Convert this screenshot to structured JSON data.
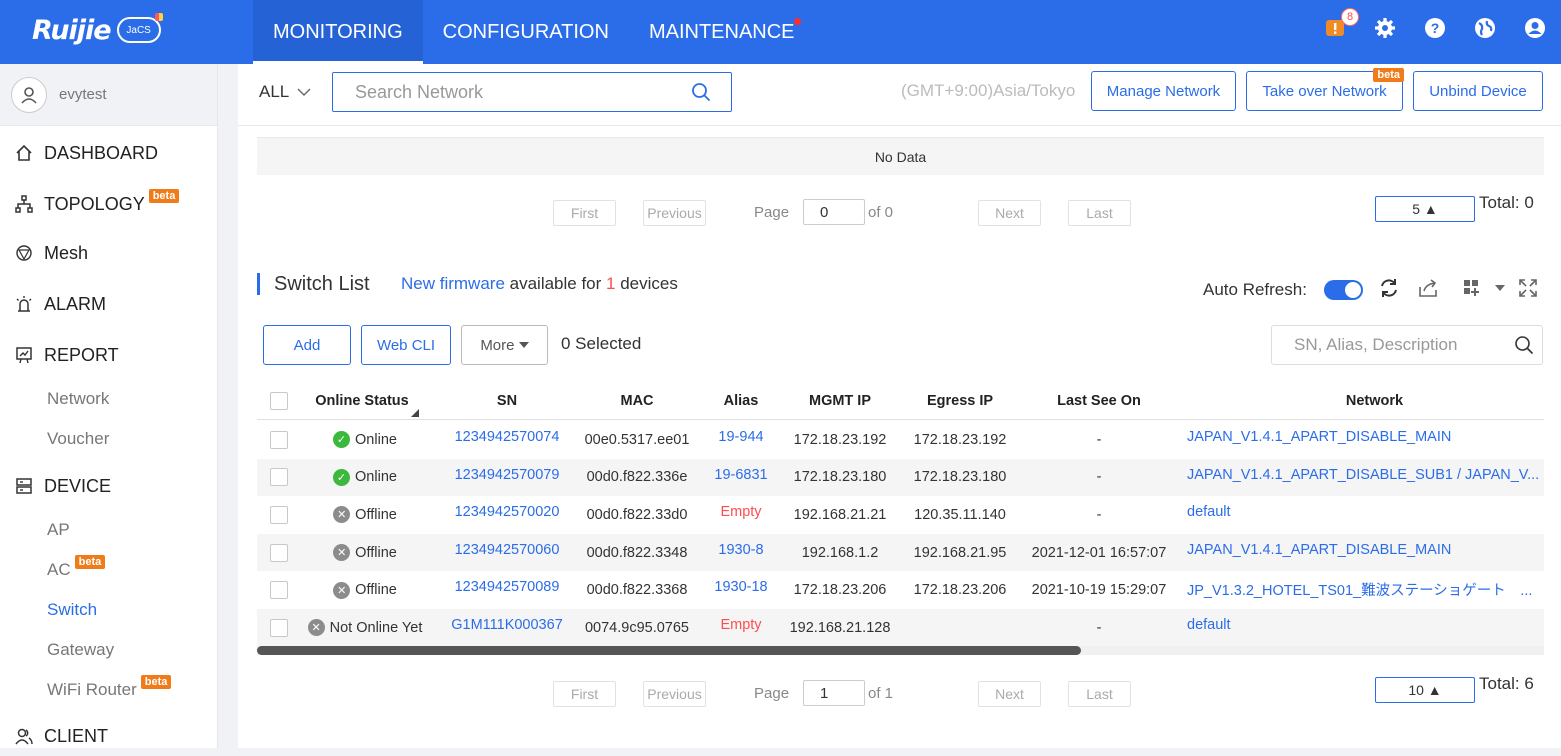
{
  "header": {
    "brand": "Ruijie",
    "brand_sub": "JaCS",
    "nav": [
      {
        "label": "MONITORING",
        "active": true
      },
      {
        "label": "CONFIGURATION",
        "active": false
      },
      {
        "label": "MAINTENANCE",
        "active": false,
        "has_dot": true
      }
    ],
    "alert_count": "8",
    "icons": [
      "alert-icon",
      "gear-icon",
      "help-icon",
      "globe-icon",
      "user-icon"
    ]
  },
  "sidebar": {
    "username": "evytest",
    "items": [
      {
        "label": "DASHBOARD",
        "icon": "home-icon"
      },
      {
        "label": "TOPOLOGY",
        "icon": "topology-icon",
        "beta": "beta"
      },
      {
        "label": "Mesh",
        "icon": "mesh-icon"
      },
      {
        "label": "ALARM",
        "icon": "alarm-icon"
      },
      {
        "label": "REPORT",
        "icon": "report-icon"
      },
      {
        "label": "DEVICE",
        "icon": "device-icon"
      },
      {
        "label": "CLIENT",
        "icon": "client-icon"
      }
    ],
    "report_sub": [
      "Network",
      "Voucher"
    ],
    "device_sub": [
      {
        "label": "AP"
      },
      {
        "label": "AC",
        "beta": "beta"
      },
      {
        "label": "Switch",
        "active": true
      },
      {
        "label": "Gateway"
      },
      {
        "label": "WiFi Router",
        "beta": "beta"
      }
    ]
  },
  "toolbar": {
    "scope": "ALL",
    "search_placeholder": "Search Network",
    "timezone": "(GMT+9:00)Asia/Tokyo",
    "manage": "Manage Network",
    "takeover": "Take over Network",
    "takeover_beta": "beta",
    "unbind": "Unbind Device"
  },
  "top_table": {
    "empty": "No Data",
    "pager": {
      "first": "First",
      "previous": "Previous",
      "page_label": "Page",
      "page": "0",
      "of": "of 0",
      "next": "Next",
      "last": "Last",
      "size": "5 ▲",
      "total": "Total: 0"
    }
  },
  "switch_list": {
    "title": "Switch List",
    "fw_link": "New firmware",
    "fw_mid": " available for ",
    "fw_count": "1",
    "fw_end": " devices",
    "auto_refresh": "Auto Refresh:",
    "auto_refresh_on": true,
    "add": "Add",
    "webcli": "Web CLI",
    "more": "More",
    "selected": "0 Selected",
    "search_placeholder": "SN, Alias, Description",
    "columns": [
      "Online Status",
      "SN",
      "MAC",
      "Alias",
      "MGMT IP",
      "Egress IP",
      "Last See On",
      "Network"
    ],
    "rows": [
      {
        "status": "Online",
        "status_kind": "online",
        "sn": "1234942570074",
        "mac": "00e0.5317.ee01",
        "alias": "19-944",
        "alias_empty": false,
        "mgmt_ip": "172.18.23.192",
        "egress_ip": "172.18.23.192",
        "last_seen": "-",
        "network": "JAPAN_V1.4.1_APART_DISABLE_MAIN"
      },
      {
        "status": "Online",
        "status_kind": "online",
        "sn": "1234942570079",
        "mac": "00d0.f822.336e",
        "alias": "19-6831",
        "alias_empty": false,
        "mgmt_ip": "172.18.23.180",
        "egress_ip": "172.18.23.180",
        "last_seen": "-",
        "network": "JAPAN_V1.4.1_APART_DISABLE_SUB1 / JAPAN_V..."
      },
      {
        "status": "Offline",
        "status_kind": "offline",
        "sn": "1234942570020",
        "mac": "00d0.f822.33d0",
        "alias": "Empty",
        "alias_empty": true,
        "mgmt_ip": "192.168.21.21",
        "egress_ip": "120.35.11.140",
        "last_seen": "-",
        "network": "default"
      },
      {
        "status": "Offline",
        "status_kind": "offline",
        "sn": "1234942570060",
        "mac": "00d0.f822.3348",
        "alias": "1930-8",
        "alias_empty": false,
        "mgmt_ip": "192.168.1.2",
        "egress_ip": "192.168.21.95",
        "last_seen": "2021-12-01 16:57:07",
        "network": "JAPAN_V1.4.1_APART_DISABLE_MAIN"
      },
      {
        "status": "Offline",
        "status_kind": "offline",
        "sn": "1234942570089",
        "mac": "00d0.f822.3368",
        "alias": "1930-18",
        "alias_empty": false,
        "mgmt_ip": "172.18.23.206",
        "egress_ip": "172.18.23.206",
        "last_seen": "2021-10-19 15:29:07",
        "network": "JP_V1.3.2_HOTEL_TS01_難波ステーショゲート　..."
      },
      {
        "status": "Not Online Yet",
        "status_kind": "never",
        "sn": "G1M111K000367",
        "mac": "0074.9c95.0765",
        "alias": "Empty",
        "alias_empty": true,
        "mgmt_ip": "192.168.21.128",
        "egress_ip": "",
        "last_seen": "-",
        "network": "default"
      }
    ],
    "pager": {
      "first": "First",
      "previous": "Previous",
      "page_label": "Page",
      "page": "1",
      "of": "of 1",
      "next": "Next",
      "last": "Last",
      "size": "10 ▲",
      "total": "Total: 6"
    }
  },
  "colors": {
    "brand_blue": "#2b6de8",
    "online": "#3cb83c",
    "offline": "#8c8c8c",
    "beta": "#f07b1a",
    "danger": "#ff4d4f"
  }
}
